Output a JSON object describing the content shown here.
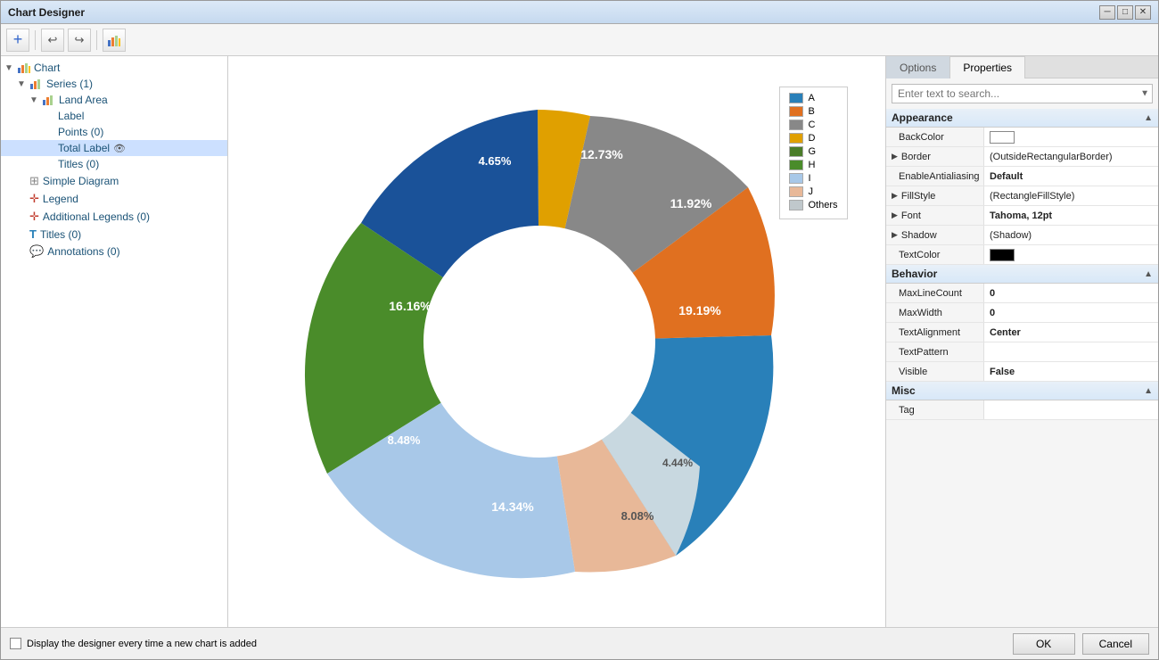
{
  "window": {
    "title": "Chart Designer"
  },
  "toolbar": {
    "add_icon": "+",
    "undo_icon": "↩",
    "redo_icon": "↪",
    "chart_icon": "📊"
  },
  "tree": {
    "items": [
      {
        "id": "chart",
        "label": "Chart",
        "level": 0,
        "icon": "📊",
        "expand": "▼",
        "selected": false
      },
      {
        "id": "series",
        "label": "Series (1)",
        "level": 1,
        "icon": "📊",
        "expand": "▼",
        "selected": false
      },
      {
        "id": "land-area",
        "label": "Land Area",
        "level": 2,
        "icon": "📊",
        "expand": "▼",
        "selected": false
      },
      {
        "id": "label",
        "label": "Label",
        "level": 3,
        "icon": "",
        "expand": "",
        "selected": false
      },
      {
        "id": "points",
        "label": "Points (0)",
        "level": 3,
        "icon": "",
        "expand": "",
        "selected": false
      },
      {
        "id": "total-label",
        "label": "Total Label",
        "level": 3,
        "icon": "",
        "expand": "",
        "selected": true
      },
      {
        "id": "titles",
        "label": "Titles (0)",
        "level": 3,
        "icon": "",
        "expand": "",
        "selected": false
      },
      {
        "id": "simple-diagram",
        "label": "Simple Diagram",
        "level": 1,
        "icon": "⊞",
        "expand": "",
        "selected": false
      },
      {
        "id": "legend",
        "label": "Legend",
        "level": 1,
        "icon": "✛",
        "expand": "",
        "selected": false
      },
      {
        "id": "additional-legends",
        "label": "Additional Legends (0)",
        "level": 1,
        "icon": "✛",
        "expand": "",
        "selected": false
      },
      {
        "id": "titles-root",
        "label": "Titles (0)",
        "level": 1,
        "icon": "T",
        "expand": "",
        "selected": false
      },
      {
        "id": "annotations",
        "label": "Annotations (0)",
        "level": 1,
        "icon": "💬",
        "expand": "",
        "selected": false
      }
    ]
  },
  "chart": {
    "segments": [
      {
        "label": "A",
        "pct": "19.19%",
        "color": "#2980b9",
        "startAngle": -20,
        "sweep": 69
      },
      {
        "label": "B",
        "pct": "11.92%",
        "color": "#e07020",
        "startAngle": 49,
        "sweep": 43
      },
      {
        "label": "C",
        "pct": "12.73%",
        "color": "#888888",
        "startAngle": 92,
        "sweep": 46
      },
      {
        "label": "D",
        "pct": "4.65%",
        "color": "#e0a000",
        "startAngle": 138,
        "sweep": 17
      },
      {
        "label": "G",
        "pct": "16.16%",
        "color": "#1a5299",
        "startAngle": 155,
        "sweep": 58
      },
      {
        "label": "H",
        "pct": "8.48%",
        "color": "#4a8c2a",
        "startAngle": 213,
        "sweep": 31
      },
      {
        "label": "I",
        "pct": "14.34%",
        "color": "#a8c8e8",
        "startAngle": 244,
        "sweep": 52
      },
      {
        "label": "J",
        "pct": "8.08%",
        "color": "#e8b898",
        "startAngle": 296,
        "sweep": 29
      },
      {
        "label": "Others",
        "pct": "4.44%",
        "color": "#c8d8e0",
        "startAngle": 325,
        "sweep": 16
      }
    ]
  },
  "legend": {
    "items": [
      {
        "label": "A",
        "color": "#2980b9"
      },
      {
        "label": "B",
        "color": "#e07020"
      },
      {
        "label": "C",
        "color": "#888888"
      },
      {
        "label": "D",
        "color": "#e0a000"
      },
      {
        "label": "G",
        "color": "#4a7c29"
      },
      {
        "label": "H",
        "color": "#4a8c2a"
      },
      {
        "label": "I",
        "color": "#a8c8e8"
      },
      {
        "label": "J",
        "color": "#e8b898"
      },
      {
        "label": "Others",
        "color": "#c0c8cc"
      }
    ]
  },
  "tabs": {
    "options_label": "Options",
    "properties_label": "Properties"
  },
  "search": {
    "placeholder": "Enter text to search..."
  },
  "properties": {
    "sections": [
      {
        "name": "Appearance",
        "rows": [
          {
            "prop": "BackColor",
            "value": "",
            "type": "color-white"
          },
          {
            "prop": "Border",
            "value": "(OutsideRectangularBorder)",
            "type": "expandable"
          },
          {
            "prop": "EnableAntialiasing",
            "value": "Default",
            "type": "bold"
          },
          {
            "prop": "FillStyle",
            "value": "(RectangleFillStyle)",
            "type": "expandable"
          },
          {
            "prop": "Font",
            "value": "Tahoma, 12pt",
            "type": "bold-expandable"
          },
          {
            "prop": "Shadow",
            "value": "(Shadow)",
            "type": "expandable"
          },
          {
            "prop": "TextColor",
            "value": "",
            "type": "color-black"
          }
        ]
      },
      {
        "name": "Behavior",
        "rows": [
          {
            "prop": "MaxLineCount",
            "value": "0",
            "type": "bold"
          },
          {
            "prop": "MaxWidth",
            "value": "0",
            "type": "bold"
          },
          {
            "prop": "TextAlignment",
            "value": "Center",
            "type": "bold"
          },
          {
            "prop": "TextPattern",
            "value": "",
            "type": "normal"
          },
          {
            "prop": "Visible",
            "value": "False",
            "type": "bold"
          }
        ]
      },
      {
        "name": "Misc",
        "rows": [
          {
            "prop": "Tag",
            "value": "",
            "type": "normal"
          }
        ]
      }
    ]
  },
  "bottom": {
    "checkbox_label": "Display the designer every time a new chart is added",
    "ok_label": "OK",
    "cancel_label": "Cancel"
  }
}
